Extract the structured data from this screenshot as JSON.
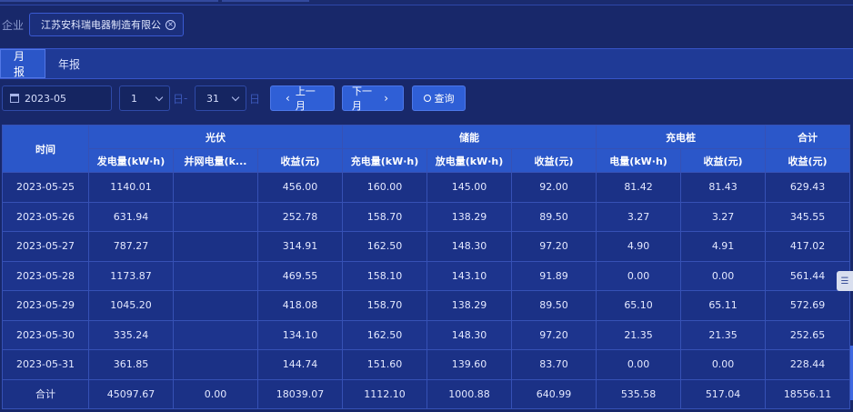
{
  "filter": {
    "label": "企业",
    "company": "江苏安科瑞电器制造有限公",
    "close_glyph": "×"
  },
  "tabs": [
    {
      "label": "月报",
      "active": true
    },
    {
      "label": "年报",
      "active": false
    }
  ],
  "controls": {
    "month_value": "2023-05",
    "start_day": "1",
    "start_unit": "日",
    "separator": "-",
    "end_day": "31",
    "end_unit": "日",
    "prev_label": "上一月",
    "next_label": "下一月",
    "search_label": "查询"
  },
  "table": {
    "header_groups": {
      "time": "时间",
      "pv": "光伏",
      "storage": "储能",
      "charger": "充电桩",
      "total": "合计"
    },
    "sub_headers": {
      "pv_generation": "发电量(kW·h)",
      "pv_grid": "并网电量(k...",
      "pv_income": "收益(元)",
      "storage_charge": "充电量(kW·h)",
      "storage_discharge": "放电量(kW·h)",
      "storage_income": "收益(元)",
      "charger_energy": "电量(kW·h)",
      "charger_income": "收益(元)",
      "total_income": "收益(元)"
    },
    "rows": [
      [
        "2023-05-25",
        "1140.01",
        "",
        "456.00",
        "160.00",
        "145.00",
        "92.00",
        "81.42",
        "81.43",
        "629.43"
      ],
      [
        "2023-05-26",
        "631.94",
        "",
        "252.78",
        "158.70",
        "138.29",
        "89.50",
        "3.27",
        "3.27",
        "345.55"
      ],
      [
        "2023-05-27",
        "787.27",
        "",
        "314.91",
        "162.50",
        "148.30",
        "97.20",
        "4.90",
        "4.91",
        "417.02"
      ],
      [
        "2023-05-28",
        "1173.87",
        "",
        "469.55",
        "158.10",
        "143.10",
        "91.89",
        "0.00",
        "0.00",
        "561.44"
      ],
      [
        "2023-05-29",
        "1045.20",
        "",
        "418.08",
        "158.70",
        "138.29",
        "89.50",
        "65.10",
        "65.11",
        "572.69"
      ],
      [
        "2023-05-30",
        "335.24",
        "",
        "134.10",
        "162.50",
        "148.30",
        "97.20",
        "21.35",
        "21.35",
        "252.65"
      ],
      [
        "2023-05-31",
        "361.85",
        "",
        "144.74",
        "151.60",
        "139.60",
        "83.70",
        "0.00",
        "0.00",
        "228.44"
      ]
    ],
    "total_row": [
      "合计",
      "45097.67",
      "0.00",
      "18039.07",
      "1112.10",
      "1000.88",
      "640.99",
      "535.58",
      "517.04",
      "18556.11"
    ]
  },
  "side_tool": {
    "icon": "sliders-icon",
    "glyph": "☰"
  }
}
